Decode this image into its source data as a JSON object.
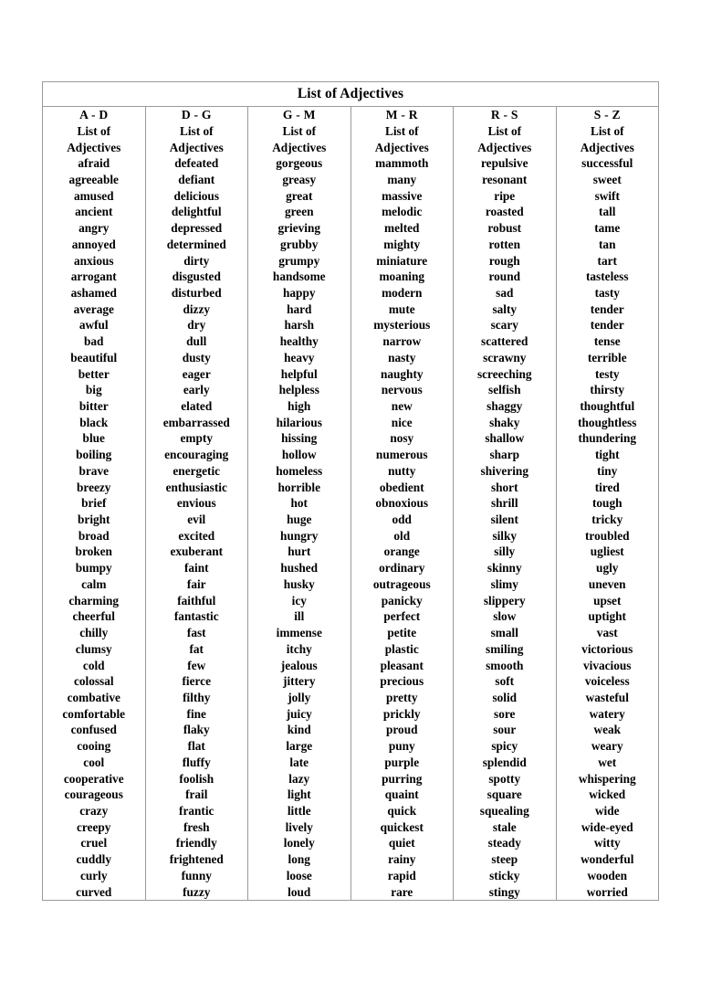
{
  "document": {
    "title": "List of Adjectives",
    "page_background": "#ffffff",
    "table_border_color": "#9a9a9a",
    "text_color": "#000000"
  },
  "table": {
    "title": "List of Adjectives",
    "column_count": 6,
    "columns": [
      {
        "header": "A - D",
        "words": [
          "List of",
          "Adjectives",
          "afraid",
          "agreeable",
          "amused",
          "ancient",
          "angry",
          "annoyed",
          "anxious",
          "arrogant",
          "ashamed",
          "average",
          "awful",
          "bad",
          "beautiful",
          "better",
          "big",
          "bitter",
          "black",
          "blue",
          "boiling",
          "brave",
          "breezy",
          "brief",
          "bright",
          "broad",
          "broken",
          "bumpy",
          "calm",
          "charming",
          "cheerful",
          "chilly",
          "clumsy",
          "cold",
          "colossal",
          "combative",
          "comfortable",
          "confused",
          "cooing",
          "cool",
          "cooperative",
          "courageous",
          "crazy",
          "creepy",
          "cruel",
          "cuddly",
          "curly",
          "curved"
        ]
      },
      {
        "header": "D - G",
        "words": [
          "List of",
          "Adjectives",
          "defeated",
          "defiant",
          "delicious",
          "delightful",
          "depressed",
          "determined",
          "dirty",
          "disgusted",
          "disturbed",
          "dizzy",
          "dry",
          "dull",
          "dusty",
          "eager",
          "early",
          "elated",
          "embarrassed",
          "empty",
          "encouraging",
          "energetic",
          "enthusiastic",
          "envious",
          "evil",
          "excited",
          "exuberant",
          "faint",
          "fair",
          "faithful",
          "fantastic",
          "fast",
          "fat",
          "few",
          "fierce",
          "filthy",
          "fine",
          "flaky",
          "flat",
          "fluffy",
          "foolish",
          "frail",
          "frantic",
          "fresh",
          "friendly",
          "frightened",
          "funny",
          "fuzzy"
        ]
      },
      {
        "header": "G - M",
        "words": [
          "List of",
          "Adjectives",
          "gorgeous",
          "greasy",
          "great",
          "green",
          "grieving",
          "grubby",
          "grumpy",
          "handsome",
          "happy",
          "hard",
          "harsh",
          "healthy",
          "heavy",
          "helpful",
          "helpless",
          "high",
          "hilarious",
          "hissing",
          "hollow",
          "homeless",
          "horrible",
          "hot",
          "huge",
          "hungry",
          "hurt",
          "hushed",
          "husky",
          "icy",
          "ill",
          "immense",
          "itchy",
          "jealous",
          "jittery",
          "jolly",
          "juicy",
          "kind",
          "large",
          "late",
          "lazy",
          "light",
          "little",
          "lively",
          "lonely",
          "long",
          "loose",
          "loud"
        ]
      },
      {
        "header": "M - R",
        "words": [
          "List of",
          "Adjectives",
          "mammoth",
          "many",
          "massive",
          "melodic",
          "melted",
          "mighty",
          "miniature",
          "moaning",
          "modern",
          "mute",
          "mysterious",
          "narrow",
          "nasty",
          "naughty",
          "nervous",
          "new",
          "nice",
          "nosy",
          "numerous",
          "nutty",
          "obedient",
          "obnoxious",
          "odd",
          "old",
          "orange",
          "ordinary",
          "outrageous",
          "panicky",
          "perfect",
          "petite",
          "plastic",
          "pleasant",
          "precious",
          "pretty",
          "prickly",
          "proud",
          "puny",
          "purple",
          "purring",
          "quaint",
          "quick",
          "quickest",
          "quiet",
          "rainy",
          "rapid",
          "rare"
        ]
      },
      {
        "header": "R - S",
        "words": [
          "List of",
          "Adjectives",
          "repulsive",
          "resonant",
          "ripe",
          "roasted",
          "robust",
          "rotten",
          "rough",
          "round",
          "sad",
          "salty",
          "scary",
          "scattered",
          "scrawny",
          "screeching",
          "selfish",
          "shaggy",
          "shaky",
          "shallow",
          "sharp",
          "shivering",
          "short",
          "shrill",
          "silent",
          "silky",
          "silly",
          "skinny",
          "slimy",
          "slippery",
          "slow",
          "small",
          "smiling",
          "smooth",
          "soft",
          "solid",
          "sore",
          "sour",
          "spicy",
          "splendid",
          "spotty",
          "square",
          "squealing",
          "stale",
          "steady",
          "steep",
          "sticky",
          "stingy"
        ]
      },
      {
        "header": "S - Z",
        "words": [
          "List of",
          "Adjectives",
          "successful",
          "sweet",
          "swift",
          "tall",
          "tame",
          "tan",
          "tart",
          "tasteless",
          "tasty",
          "tender",
          "tender",
          "tense",
          "terrible",
          "testy",
          "thirsty",
          "thoughtful",
          "thoughtless",
          "thundering",
          "tight",
          "tiny",
          "tired",
          "tough",
          "tricky",
          "troubled",
          "ugliest",
          "ugly",
          "uneven",
          "upset",
          "uptight",
          "vast",
          "victorious",
          "vivacious",
          "voiceless",
          "wasteful",
          "watery",
          "weak",
          "weary",
          "wet",
          "whispering",
          "wicked",
          "wide",
          "wide-eyed",
          "witty",
          "wonderful",
          "wooden",
          "worried"
        ]
      }
    ]
  }
}
